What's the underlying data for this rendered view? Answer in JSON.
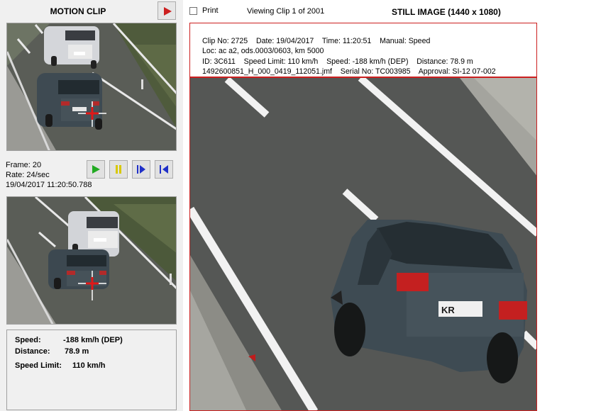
{
  "motion_clip": {
    "title": "MOTION CLIP",
    "frame_text": "Frame: 20",
    "rate_text": "Rate: 24/sec",
    "timestamp": "19/04/2017 11:20:50.788"
  },
  "summary": {
    "speed_label": "Speed:",
    "speed_value": "-188 km/h (DEP)",
    "distance_label": "Distance:",
    "distance_value": "78.9 m",
    "limit_label": "Speed Limit:",
    "limit_value": "110 km/h"
  },
  "toolbar": {
    "print_label": "Print",
    "print_checked": false,
    "viewing_text": "Viewing Clip 1 of 2001",
    "still_title": "STILL IMAGE (1440 x 1080)"
  },
  "still_meta": {
    "line1": "Clip No: 2725    Date: 19/04/2017    Time: 11:20:51    Manual: Speed",
    "line2": "Loc: ac a2, ods.0003/0603, km 5000",
    "line3": "ID: 3C611    Speed Limit: 110 km/h    Speed: -188 km/h (DEP)    Distance: 78.9 m",
    "line4": "1492600851_H_000_0419_112051.jmf    Serial No: TC003985    Approval: SI-12 07-002"
  },
  "still_image": {
    "plate_text": "KR"
  },
  "colors": {
    "accent_red": "#cc1f1f",
    "play_green": "#22aa22",
    "pause_yellow": "#d8c800",
    "nav_blue": "#2030c8"
  },
  "icons": [
    "play-red-icon",
    "play-icon",
    "pause-icon",
    "step-forward-icon",
    "step-back-icon"
  ]
}
